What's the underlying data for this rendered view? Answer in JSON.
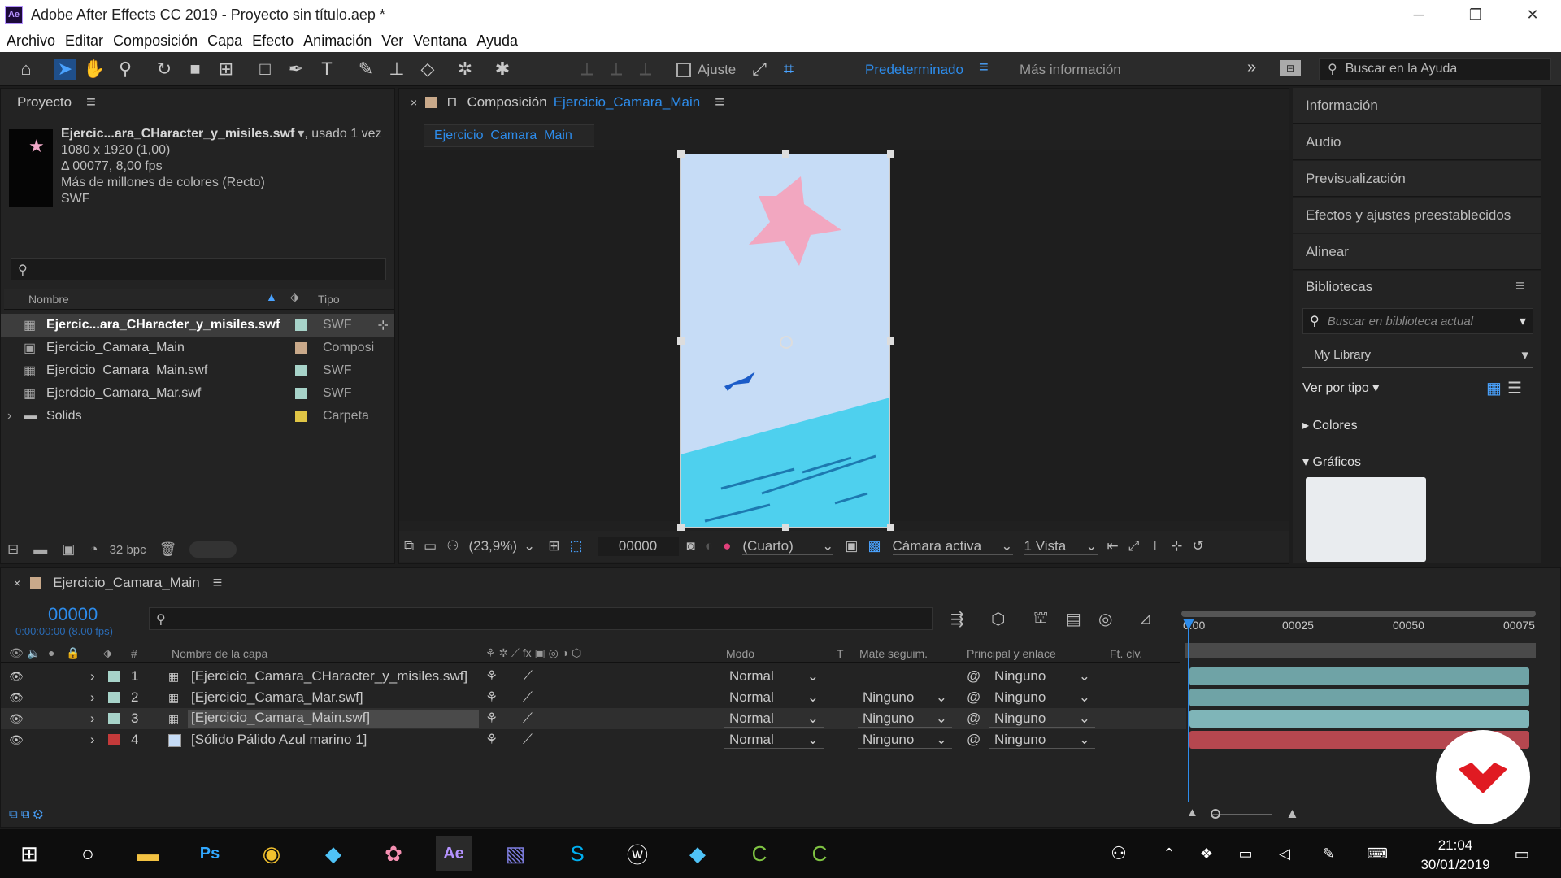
{
  "window": {
    "title": "Adobe After Effects CC 2019 - Proyecto sin título.aep *",
    "logo": "Ae"
  },
  "menu": [
    "Archivo",
    "Editar",
    "Composición",
    "Capa",
    "Efecto",
    "Animación",
    "Ver",
    "Ventana",
    "Ayuda"
  ],
  "toolbar": {
    "snap_label": "Ajuste",
    "workspace": "Predeterminado",
    "more_info": "Más información",
    "help_search_placeholder": "Buscar en la Ayuda"
  },
  "project": {
    "title": "Proyecto",
    "selected_name": "Ejercic...ara_CHaracter_y_misiles.swf",
    "used": ", usado 1 vez",
    "dims": "1080 x 1920 (1,00)",
    "duration": "Δ 00077, 8,00 fps",
    "colors": "Más de millones de colores (Recto)",
    "format": "SWF",
    "col_name": "Nombre",
    "col_type": "Tipo",
    "items": [
      {
        "name": "Ejercic...ara_CHaracter_y_misiles.swf",
        "type": "SWF",
        "color": "#a7d3c9"
      },
      {
        "name": "Ejercicio_Camara_Main",
        "type": "Composi",
        "color": "#c9a98a"
      },
      {
        "name": "Ejercicio_Camara_Main.swf",
        "type": "SWF",
        "color": "#a7d3c9"
      },
      {
        "name": "Ejercicio_Camara_Mar.swf",
        "type": "SWF",
        "color": "#a7d3c9"
      },
      {
        "name": "Solids",
        "type": "Carpeta",
        "color": "#e0c545"
      }
    ],
    "bpc": "32 bpc"
  },
  "composition": {
    "header_label": "Composición",
    "name": "Ejercicio_Camara_Main",
    "tab": "Ejercicio_Camara_Main",
    "zoom": "(23,9%)",
    "timecode": "00000",
    "resolution": "(Cuarto)",
    "camera": "Cámara activa",
    "views": "1 Vista"
  },
  "right_panel": {
    "items": [
      "Información",
      "Audio",
      "Previsualización",
      "Efectos y ajustes preestablecidos",
      "Alinear",
      "Bibliotecas"
    ],
    "lib_search_placeholder": "Buscar en biblioteca actual",
    "library": "My Library",
    "view_by": "Ver por tipo",
    "sections": [
      "Colores",
      "Gráficos"
    ]
  },
  "timeline": {
    "comp_name": "Ejercicio_Camara_Main",
    "timecode": "00000",
    "sub_timecode": "0:00:00:00 (8.00 fps)",
    "col_hash": "#",
    "col_layer": "Nombre de la capa",
    "col_mode": "Modo",
    "col_t": "T",
    "col_matte": "Mate seguim.",
    "col_parent": "Principal y enlace",
    "col_key": "Ft. clv.",
    "ruler": [
      "0:00",
      "00025",
      "00050",
      "00075"
    ],
    "layers": [
      {
        "num": "1",
        "name": "[Ejercicio_Camara_CHaracter_y_misiles.swf]",
        "mode": "Normal",
        "matte": "",
        "parent": "Ninguno",
        "color": "#a7d3c9",
        "bar": "#6fa3a6"
      },
      {
        "num": "2",
        "name": "[Ejercicio_Camara_Mar.swf]",
        "mode": "Normal",
        "matte": "Ninguno",
        "parent": "Ninguno",
        "color": "#a7d3c9",
        "bar": "#6fa3a6"
      },
      {
        "num": "3",
        "name": "[Ejercicio_Camara_Main.swf]",
        "mode": "Normal",
        "matte": "Ninguno",
        "parent": "Ninguno",
        "color": "#a7d3c9",
        "bar": "#7fb5b8"
      },
      {
        "num": "4",
        "name": "[Sólido Pálido Azul marino 1]",
        "mode": "Normal",
        "matte": "Ninguno",
        "parent": "Ninguno",
        "color": "#c43a3a",
        "bar": "#b5474f"
      }
    ]
  },
  "taskbar": {
    "time": "21:04",
    "date": "30/01/2019"
  }
}
